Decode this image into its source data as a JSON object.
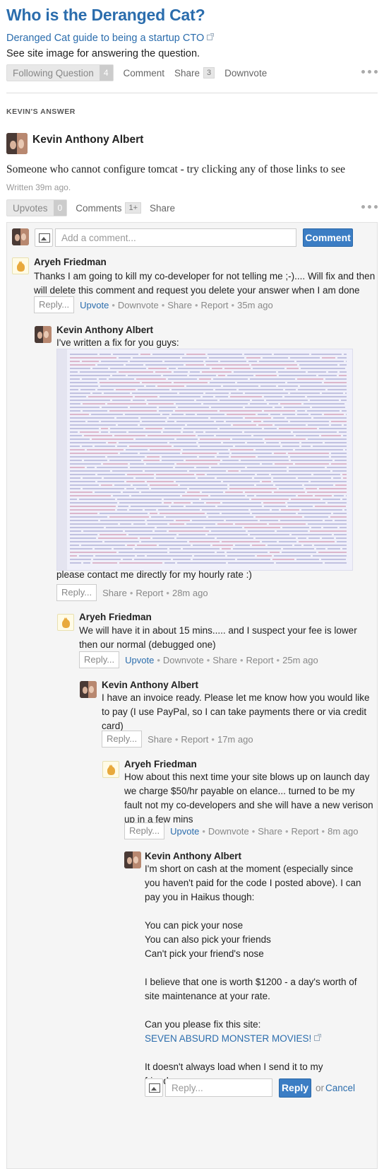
{
  "question": {
    "title": "Who is the Deranged Cat?",
    "topic_link": "Deranged Cat guide to being a startup CTO",
    "detail": "See site image for answering the question.",
    "actions": {
      "following_label": "Following Question",
      "following_count": "4",
      "comment_label": "Comment",
      "share_label": "Share",
      "share_count": "3",
      "downvote_label": "Downvote"
    }
  },
  "answer": {
    "section_label": "KEVIN'S ANSWER",
    "author": "Kevin Anthony Albert",
    "body": "Someone who cannot configure tomcat - try clicking any of those links to see",
    "time": "Written 39m ago.",
    "actions": {
      "upvotes_label": "Upvotes",
      "upvotes_count": "0",
      "comments_label": "Comments",
      "comments_count": "1+",
      "share_label": "Share"
    }
  },
  "comment_form": {
    "placeholder": "Add a comment...",
    "submit_label": "Comment"
  },
  "labels": {
    "reply": "Reply...",
    "upvote": "Upvote",
    "downvote": "Downvote",
    "share": "Share",
    "report": "Report",
    "sep": "•"
  },
  "comments": [
    {
      "author": "Aryeh Friedman",
      "lines": [
        "Thanks I am going to kill my co-developer for not telling me ;-).... Will fix and then",
        "will delete this comment and request you delete your answer when I am done"
      ],
      "time": "35m ago"
    },
    {
      "author": "Kevin Anthony Albert",
      "intro": "I've written a fix for you guys:",
      "outro": "please contact me directly for my hourly rate :)",
      "time": "28m ago"
    },
    {
      "author": "Aryeh Friedman",
      "lines": [
        "We will have it in about 15 mins..... and I suspect your fee is lower",
        "then our normal (debugged one)"
      ],
      "time": "25m ago"
    },
    {
      "author": "Kevin Anthony Albert",
      "lines": [
        "I have an invoice ready. Please let me know how you would like",
        "to pay (I use PayPal, so I can take payments there or via credit",
        "card)"
      ],
      "time": "17m ago"
    },
    {
      "author": "Aryeh Friedman",
      "lines": [
        "How about this next time your site blows up on launch day",
        "we charge $50/hr payable on elance... turned to be my",
        "fault not my co-developers and she will have a new verison",
        "up in a few mins"
      ],
      "time": "8m ago"
    },
    {
      "author": "Kevin Anthony Albert",
      "lines": [
        "I'm short on cash at the moment (especially since",
        "you haven't paid for the code I posted above). I can",
        "pay you in Haikus though:",
        "",
        "You can pick your nose",
        "You can also pick your friends",
        "Can't pick your friend's nose",
        "",
        "I believe that one is worth $1200 - a day's worth of",
        "site maintenance at your rate.",
        "",
        "Can you please fix this site:"
      ],
      "link": "SEVEN ABSURD MONSTER MOVIES!",
      "after_link": [
        "It doesn't always load when I send it to my",
        "friends."
      ]
    }
  ],
  "reply_form": {
    "placeholder": "Reply...",
    "submit_label": "Reply",
    "or_label": "or",
    "cancel_label": "Cancel"
  },
  "colors": {
    "link": "#2b6dad",
    "button_blue": "#3b7dc4"
  }
}
